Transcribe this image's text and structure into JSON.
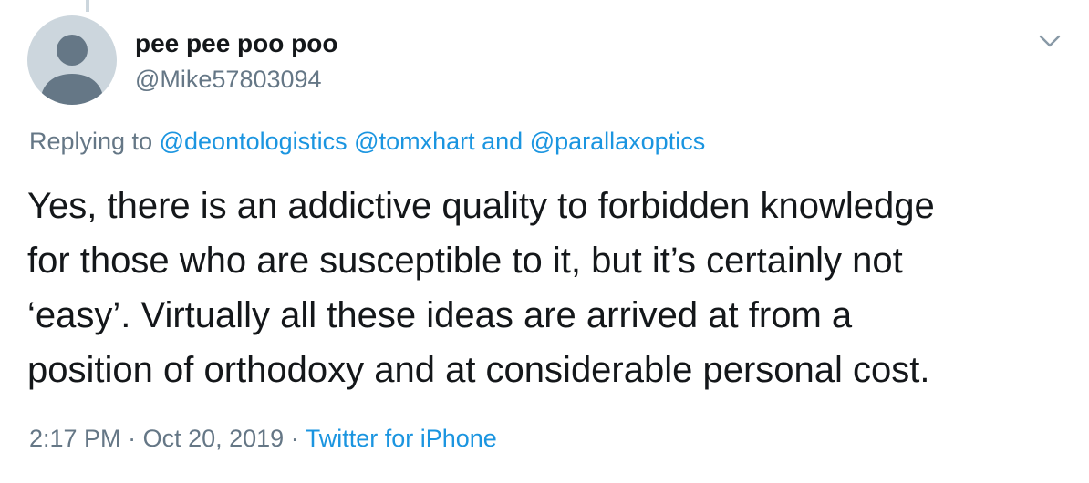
{
  "author": {
    "display_name": "pee pee poo poo",
    "handle": "@Mike57803094",
    "avatar_icon": "default-profile-icon"
  },
  "menu": {
    "icon": "chevron-down-icon"
  },
  "reply_context": {
    "prefix": "Replying to",
    "mention_1": "@deontologistics",
    "mention_2": "@tomxhart",
    "conjunction": "and",
    "mention_3": "@parallaxoptics"
  },
  "tweet": {
    "lines": [
      "Yes, there is an addictive quality to forbidden knowledge",
      "for those who are susceptible to it, but it’s certainly not",
      "‘easy’. Virtually all these ideas are arrived at from a",
      "position of orthodoxy and at considerable personal cost."
    ]
  },
  "meta": {
    "time": "2:17 PM",
    "separator_1": "·",
    "date": "Oct 20, 2019",
    "separator_2": "·",
    "source": "Twitter for iPhone"
  },
  "colors": {
    "link": "#1b95e0",
    "secondary_text": "#657786",
    "primary_text": "#14171a",
    "avatar_bg": "#ccd6dd",
    "avatar_fg": "#657786"
  }
}
